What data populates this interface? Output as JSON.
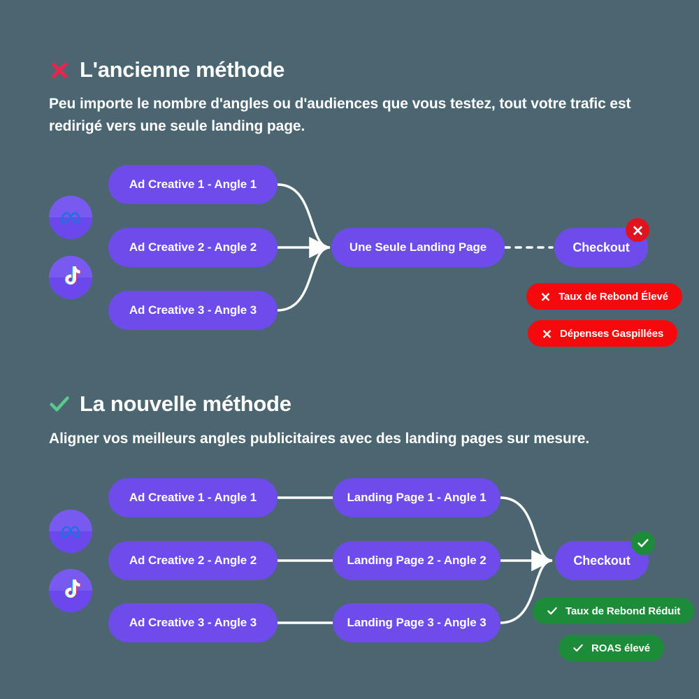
{
  "theme": {
    "background": "#4b6670",
    "node_purple": "#6d4ceb",
    "bad_red": "#f5090d",
    "badge_red": "#e0141e",
    "good_green": "#1d8c38",
    "heading_x_red": "#f0224d",
    "heading_check_green": "#5bc98e",
    "wire_white": "#ffffff"
  },
  "sections": [
    {
      "id": "old-method",
      "icon": "cross-icon",
      "title": "L'ancienne méthode",
      "subtitle": "Peu importe le nombre d'angles ou d'audiences que vous testez, tout votre trafic est redirigé vers une seule landing page.",
      "sources": [
        {
          "name": "meta-icon",
          "label": "Meta"
        },
        {
          "name": "tiktok-icon",
          "label": "TikTok"
        }
      ],
      "creatives": [
        "Ad Creative 1 -  Angle 1",
        "Ad Creative 2 -  Angle 2",
        "Ad Creative 3 -  Angle 3"
      ],
      "middle": "Une Seule Landing Page",
      "checkout": "Checkout",
      "checkout_badge": "cross-icon",
      "outcomes": [
        {
          "icon": "cross-icon",
          "label": "Taux de Rebond Élevé"
        },
        {
          "icon": "cross-icon",
          "label": "Dépenses Gaspillées"
        }
      ]
    },
    {
      "id": "new-method",
      "icon": "check-icon",
      "title": "La nouvelle méthode",
      "subtitle": "Aligner vos meilleurs angles publicitaires avec des landing pages sur mesure.",
      "sources": [
        {
          "name": "meta-icon",
          "label": "Meta"
        },
        {
          "name": "tiktok-icon",
          "label": "TikTok"
        }
      ],
      "creatives": [
        "Ad Creative 1 -  Angle 1",
        "Ad Creative 2 -  Angle 2",
        "Ad Creative 3 -  Angle 3"
      ],
      "landings": [
        "Landing Page 1 -  Angle 1",
        "Landing Page 2 -  Angle 2",
        "Landing Page 3 -  Angle 3"
      ],
      "checkout": "Checkout",
      "checkout_badge": "check-icon",
      "outcomes": [
        {
          "icon": "check-icon",
          "label": "Taux de Rebond Réduit"
        },
        {
          "icon": "check-icon",
          "label": "ROAS élevé"
        }
      ]
    }
  ]
}
